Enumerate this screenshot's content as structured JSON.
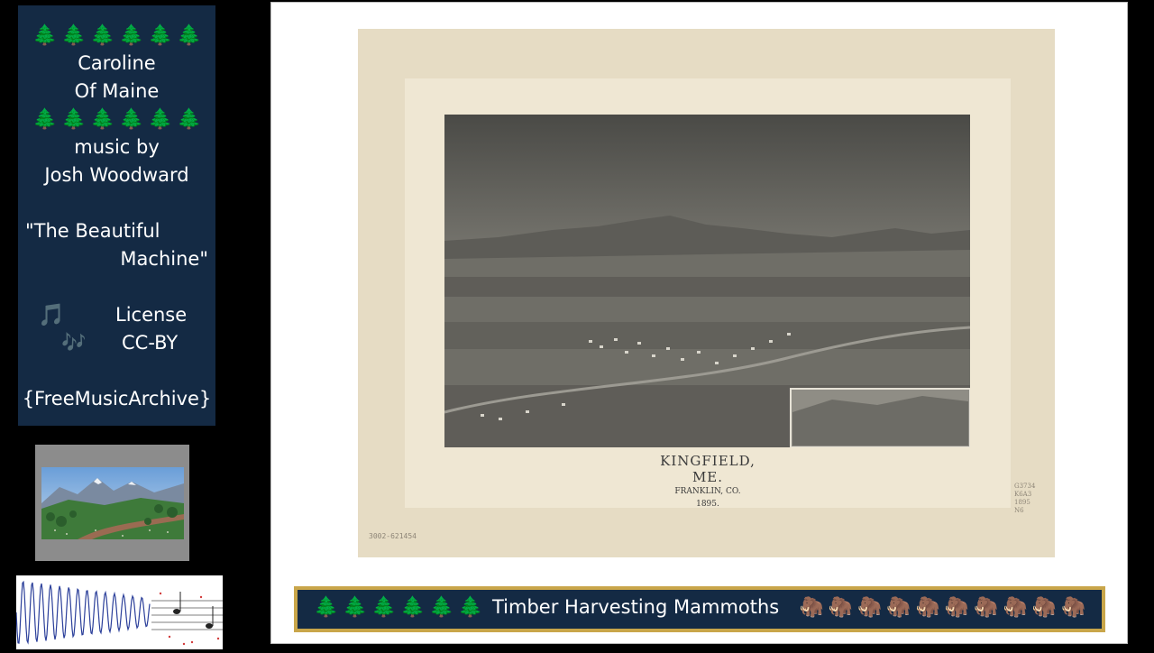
{
  "info_panel": {
    "tree_row": [
      "🌲",
      "🌲",
      "🌲",
      "🌲",
      "🌲",
      "🌲"
    ],
    "line1": "Caroline",
    "line2": "Of Maine",
    "music_by": "music by",
    "artist": "Josh Woodward",
    "album_line1": "\"The Beautiful",
    "album_line2": "Machine\"",
    "note_icon_1": "🎵",
    "note_icon_2": "🎶",
    "license_label": "License",
    "license_value": "CC-BY",
    "source": "{FreeMusicArchive}"
  },
  "map": {
    "title": "KINGFIELD, ME.",
    "county": "FRANKLIN, CO.",
    "year": "1895.",
    "catalog_number": "3002-621454",
    "hand_note": [
      "G3734",
      "K6A3",
      "1895",
      "N6"
    ]
  },
  "banner": {
    "trees": [
      "🌲",
      "🌲",
      "🌲",
      "🌲",
      "🌲",
      "🌲"
    ],
    "text": "Timber Harvesting Mammoths",
    "mammoths": [
      "🦣",
      "🦣",
      "🦣",
      "🦣",
      "🦣",
      "🦣",
      "🦣",
      "🦣",
      "🦣",
      "🦣"
    ]
  },
  "colors": {
    "panel_bg": "#142a44",
    "banner_border": "#c9a64a",
    "page_bg": "#000000"
  }
}
